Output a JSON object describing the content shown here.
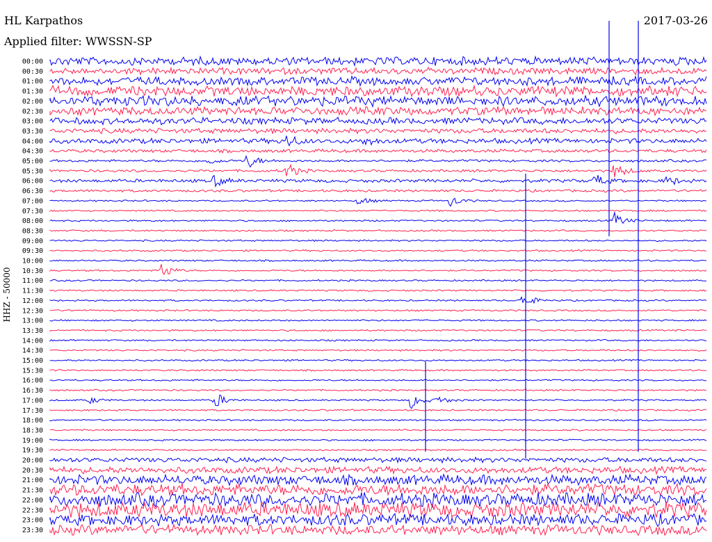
{
  "chart_data": {
    "type": "line",
    "title": "HL Karpathos",
    "subtitle": "Applied filter: WWSSN-SP",
    "date": "2017-03-26",
    "ylabel": "HHZ - 50000",
    "row_labels": [
      "00:00",
      "00:30",
      "01:00",
      "01:30",
      "02:00",
      "02:30",
      "03:00",
      "03:30",
      "04:00",
      "04:30",
      "05:00",
      "05:30",
      "06:00",
      "06:30",
      "07:00",
      "07:30",
      "08:00",
      "08:30",
      "09:00",
      "09:30",
      "10:00",
      "10:30",
      "11:00",
      "11:30",
      "12:00",
      "12:30",
      "13:00",
      "13:30",
      "14:00",
      "14:30",
      "15:00",
      "15:30",
      "16:00",
      "16:30",
      "17:00",
      "17:30",
      "18:00",
      "18:30",
      "19:00",
      "19:30",
      "20:00",
      "20:30",
      "21:00",
      "21:30",
      "22:00",
      "22:30",
      "23:00",
      "23:30"
    ],
    "series_colors": [
      "#0000ee",
      "#ff2050"
    ],
    "noise_levels": [
      5,
      4,
      5,
      6,
      6,
      5,
      4,
      3,
      3,
      2,
      1.5,
      1.5,
      2,
      1.5,
      1,
      1,
      1,
      1,
      1,
      1,
      1,
      1,
      1,
      1,
      1,
      1,
      1,
      1,
      1,
      1,
      1,
      1,
      1,
      1,
      1,
      1,
      1,
      1,
      1,
      1,
      3,
      4,
      6,
      7,
      8,
      9,
      7,
      6
    ],
    "events": [
      {
        "row": 8,
        "x": 0.36,
        "amp": 10
      },
      {
        "row": 8,
        "x": 0.48,
        "amp": 6
      },
      {
        "row": 10,
        "x": 0.3,
        "amp": 12
      },
      {
        "row": 10,
        "x": 0.24,
        "amp": 5
      },
      {
        "row": 11,
        "x": 0.36,
        "amp": 14
      },
      {
        "row": 11,
        "x": 0.86,
        "amp": 14
      },
      {
        "row": 12,
        "x": 0.25,
        "amp": 9
      },
      {
        "row": 12,
        "x": 0.83,
        "amp": 10
      },
      {
        "row": 12,
        "x": 0.94,
        "amp": 8
      },
      {
        "row": 14,
        "x": 0.47,
        "amp": 7
      },
      {
        "row": 14,
        "x": 0.61,
        "amp": 9
      },
      {
        "row": 16,
        "x": 0.86,
        "amp": 11
      },
      {
        "row": 21,
        "x": 0.17,
        "amp": 14
      },
      {
        "row": 24,
        "x": 0.72,
        "amp": 12
      },
      {
        "row": 34,
        "x": 0.25,
        "amp": 14
      },
      {
        "row": 34,
        "x": 0.55,
        "amp": 13
      },
      {
        "row": 34,
        "x": 0.59,
        "amp": 7
      },
      {
        "row": 34,
        "x": 0.06,
        "amp": 5
      }
    ]
  }
}
